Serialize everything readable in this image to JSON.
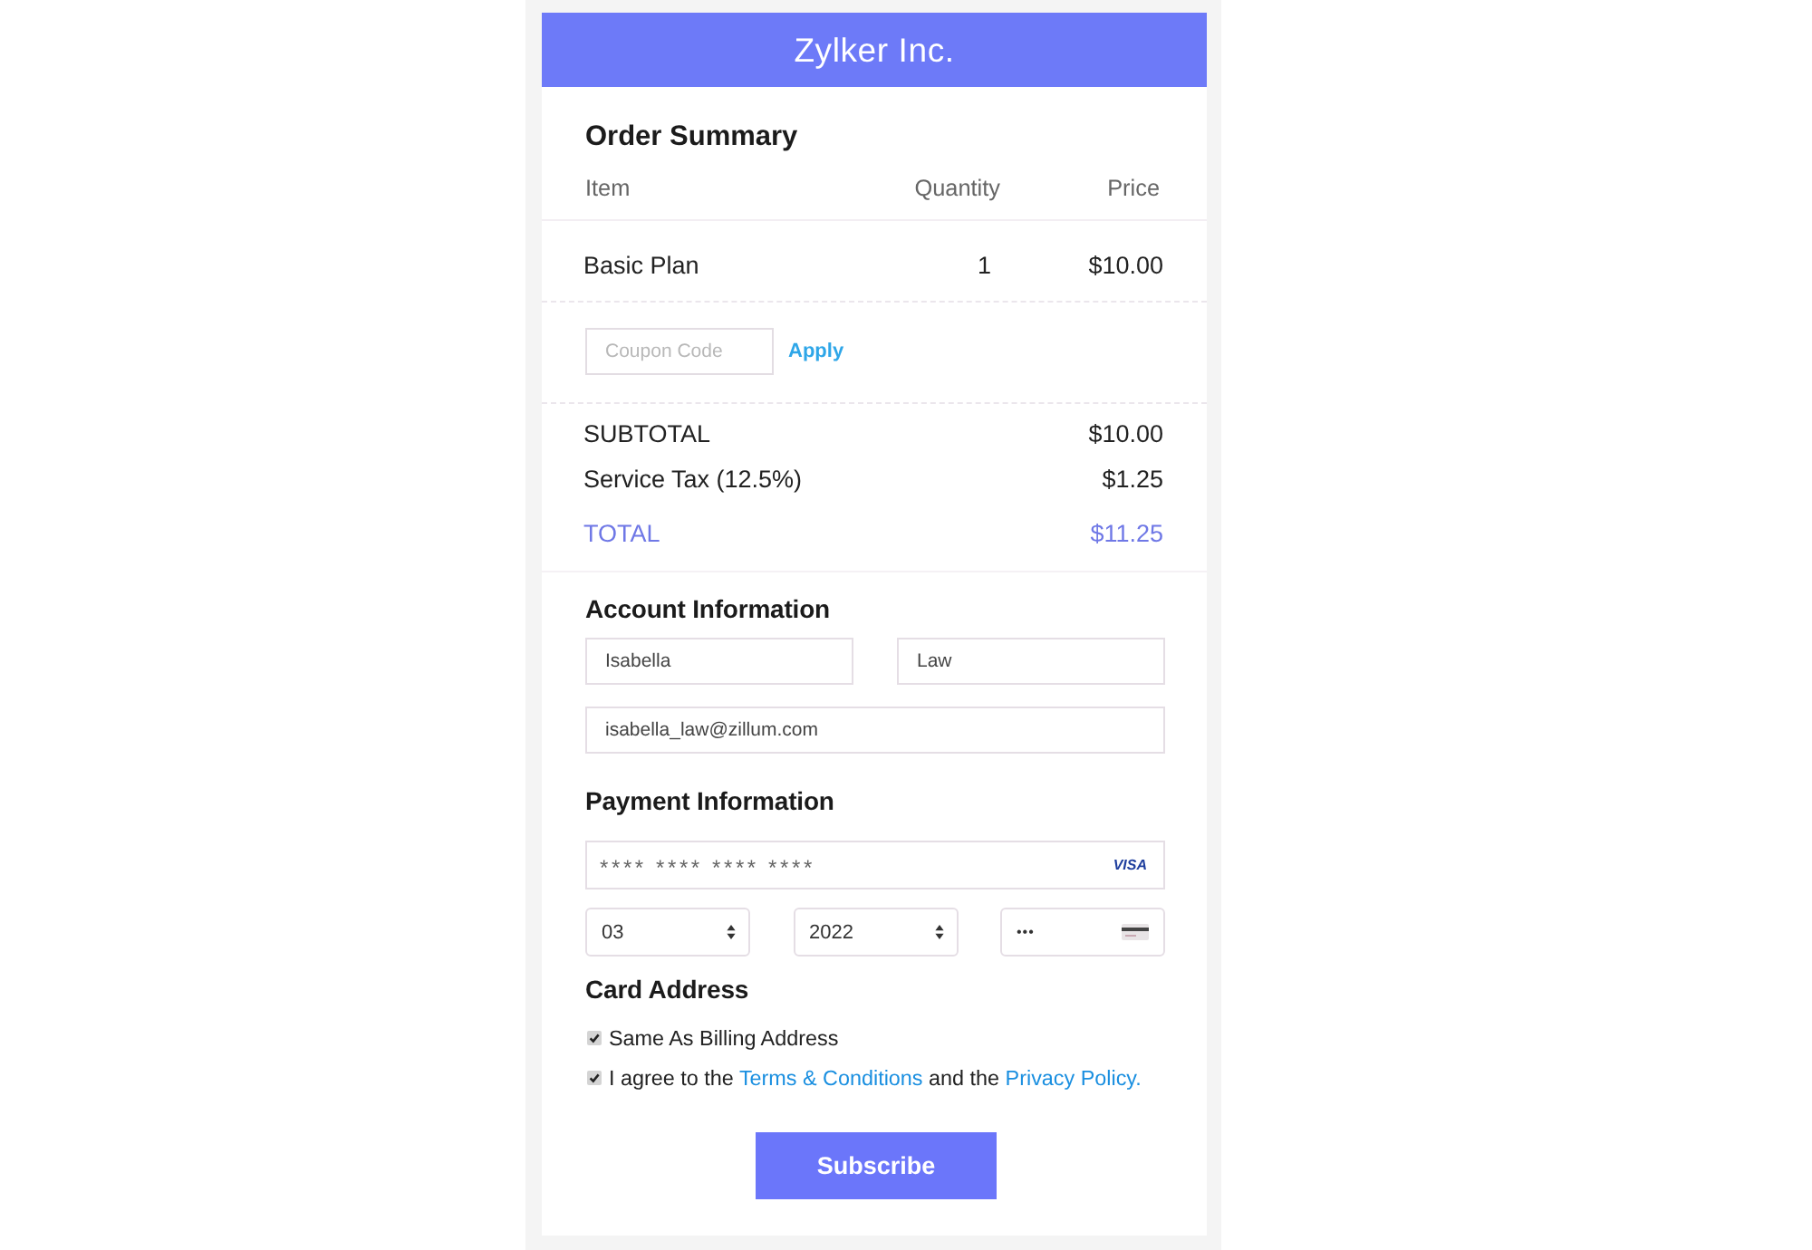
{
  "header": {
    "title": "Zylker Inc."
  },
  "order_summary": {
    "title": "Order Summary",
    "columns": [
      "Item",
      "Quantity",
      "Price"
    ],
    "rows": [
      {
        "item": "Basic Plan",
        "quantity": "1",
        "price": "$10.00"
      }
    ]
  },
  "coupon": {
    "placeholder": "Coupon Code",
    "action": "Apply"
  },
  "totals": [
    {
      "kind": "line",
      "label": "SUBTOTAL",
      "amount": "$10.00"
    },
    {
      "kind": "line",
      "label": "Service Tax (12.5%)",
      "amount": "$1.25"
    },
    {
      "kind": "grand",
      "label": "TOTAL",
      "amount": "$11.25"
    }
  ],
  "account_information": {
    "title": "Account Information",
    "first_name": "Isabella",
    "last_name": "Law",
    "email": "isabella_law@zillum.com"
  },
  "payment_information": {
    "title": "Payment Information",
    "card_number": "**** **** **** ****",
    "card_brand": "VISA",
    "expiry_month": "03",
    "expiry_year": "2022",
    "cvv": "•••"
  },
  "card_address": {
    "title": "Card Address",
    "checkboxes": [
      {
        "checked": true,
        "parts": [
          {
            "kind": "text",
            "text": "Same As Billing Address"
          }
        ]
      },
      {
        "checked": true,
        "parts": [
          {
            "kind": "text",
            "text": "I agree to the"
          },
          {
            "kind": "link",
            "text": "Terms & Conditions"
          },
          {
            "kind": "text",
            "text": "and the"
          },
          {
            "kind": "link",
            "text": "Privacy Policy."
          }
        ]
      }
    ]
  },
  "subscribe_button": "Subscribe"
}
